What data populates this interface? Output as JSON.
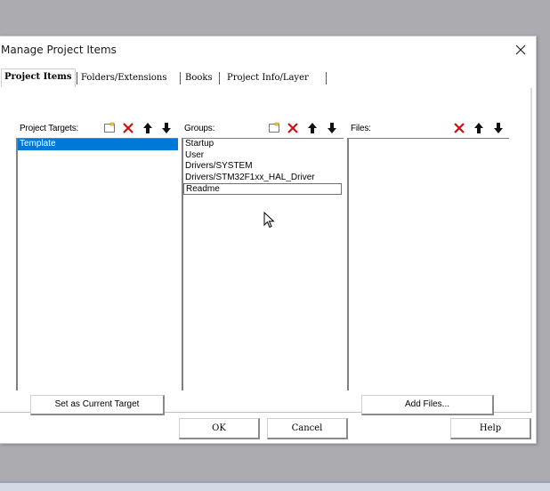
{
  "dialog": {
    "title": "Manage Project Items"
  },
  "tabs": [
    {
      "label": "Project Items",
      "active": true
    },
    {
      "label": "Folders/Extensions",
      "active": false
    },
    {
      "label": "Books",
      "active": false
    },
    {
      "label": "Project Info/Layer",
      "active": false
    }
  ],
  "targets": {
    "label": "Project Targets:",
    "items": [
      "Template"
    ],
    "selected": "Template",
    "set_current_label": "Set as Current Target"
  },
  "groups": {
    "label": "Groups:",
    "items": [
      "Startup",
      "User",
      "Drivers/SYSTEM",
      "Drivers/STM32F1xx_HAL_Driver",
      "Readme"
    ],
    "focused": "Readme"
  },
  "files": {
    "label": "Files:",
    "add_label": "Add Files..."
  },
  "footer": {
    "ok": "OK",
    "cancel": "Cancel",
    "help": "Help"
  },
  "icons": [
    "new-icon",
    "delete-icon",
    "move-up-icon",
    "move-down-icon",
    "close-icon",
    "mouse-cursor-icon"
  ],
  "colors": {
    "selection": "#0078d7",
    "delete": "#d01010"
  }
}
